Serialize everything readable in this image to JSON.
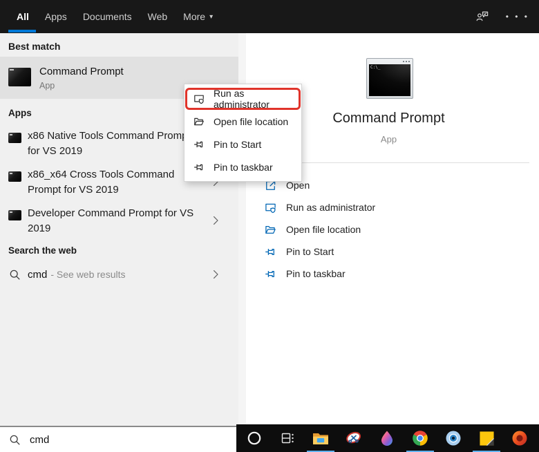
{
  "topbar": {
    "tabs": [
      {
        "label": "All",
        "selected": true
      },
      {
        "label": "Apps",
        "selected": false
      },
      {
        "label": "Documents",
        "selected": false
      },
      {
        "label": "Web",
        "selected": false
      },
      {
        "label": "More",
        "selected": false,
        "has_caret": true
      }
    ],
    "caret_glyph": "▾",
    "ellipsis_glyph": "• • •"
  },
  "left": {
    "best_match_header": "Best match",
    "best_match": {
      "title": "Command Prompt",
      "subtitle": "App"
    },
    "apps_header": "Apps",
    "apps": [
      {
        "line1": "x86 Native Tools Command Prompt",
        "line2": "for VS 2019"
      },
      {
        "line1": "x86_x64 Cross Tools Command",
        "line2": "Prompt for VS 2019"
      },
      {
        "line1": "Developer Command Prompt for VS",
        "line2": "2019"
      }
    ],
    "web_header": "Search the web",
    "web_result": {
      "query": "cmd",
      "suffix": "- See web results"
    }
  },
  "context_menu": {
    "items": [
      {
        "label": "Run as administrator",
        "annotated": true
      },
      {
        "label": "Open file location",
        "annotated": false
      },
      {
        "label": "Pin to Start",
        "annotated": false
      },
      {
        "label": "Pin to taskbar",
        "annotated": false
      }
    ]
  },
  "preview": {
    "title": "Command Prompt",
    "subtitle": "App",
    "icon_prompt": "C:\\_",
    "actions": [
      {
        "label": "Open"
      },
      {
        "label": "Run as administrator"
      },
      {
        "label": "Open file location"
      },
      {
        "label": "Pin to Start"
      },
      {
        "label": "Pin to taskbar"
      }
    ]
  },
  "search_bar": {
    "value": "cmd"
  },
  "taskbar": {
    "items": [
      {
        "name": "cortana",
        "running": false
      },
      {
        "name": "task-view",
        "running": false
      },
      {
        "name": "file-explorer",
        "running": true
      },
      {
        "name": "snipping-tool",
        "running": false
      },
      {
        "name": "paint-drop",
        "running": false
      },
      {
        "name": "chrome",
        "running": true
      },
      {
        "name": "blue-circle-app",
        "running": false
      },
      {
        "name": "sticky-notes",
        "running": true
      },
      {
        "name": "office",
        "running": false
      }
    ]
  },
  "colors": {
    "accent_blue": "#0078d7",
    "action_icon_blue": "#0066b4",
    "annotation_red": "#e0342b",
    "taskbar_underline": "#5fb2ef"
  }
}
